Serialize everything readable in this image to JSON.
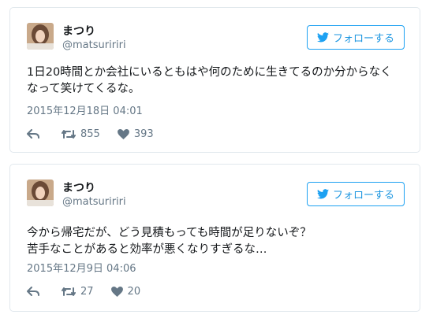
{
  "tweets": [
    {
      "name": "まつり",
      "handle": "@matsuririri",
      "follow_label": "フォローする",
      "text_lines": [
        "1日20時間とか会社にいるともはや何のために生きてるのか分からなく",
        "なって笑けてくるな。"
      ],
      "timestamp": "2015年12月18日 04:01",
      "retweets": "855",
      "likes": "393"
    },
    {
      "name": "まつり",
      "handle": "@matsuririri",
      "follow_label": "フォローする",
      "text_lines": [
        "今から帰宅だが、どう見積もっても時間が足りないぞ？",
        "苦手なことがあると効率が悪くなりすぎるな…"
      ],
      "timestamp": "2015年12月9日 04:06",
      "retweets": "27",
      "likes": "20"
    }
  ],
  "icons": {
    "bird": "twitter-bird-icon",
    "reply": "reply-icon",
    "retweet": "retweet-icon",
    "like": "heart-icon"
  },
  "colors": {
    "accent": "#1da1f2",
    "muted": "#657786",
    "border": "#e1e8ed"
  }
}
